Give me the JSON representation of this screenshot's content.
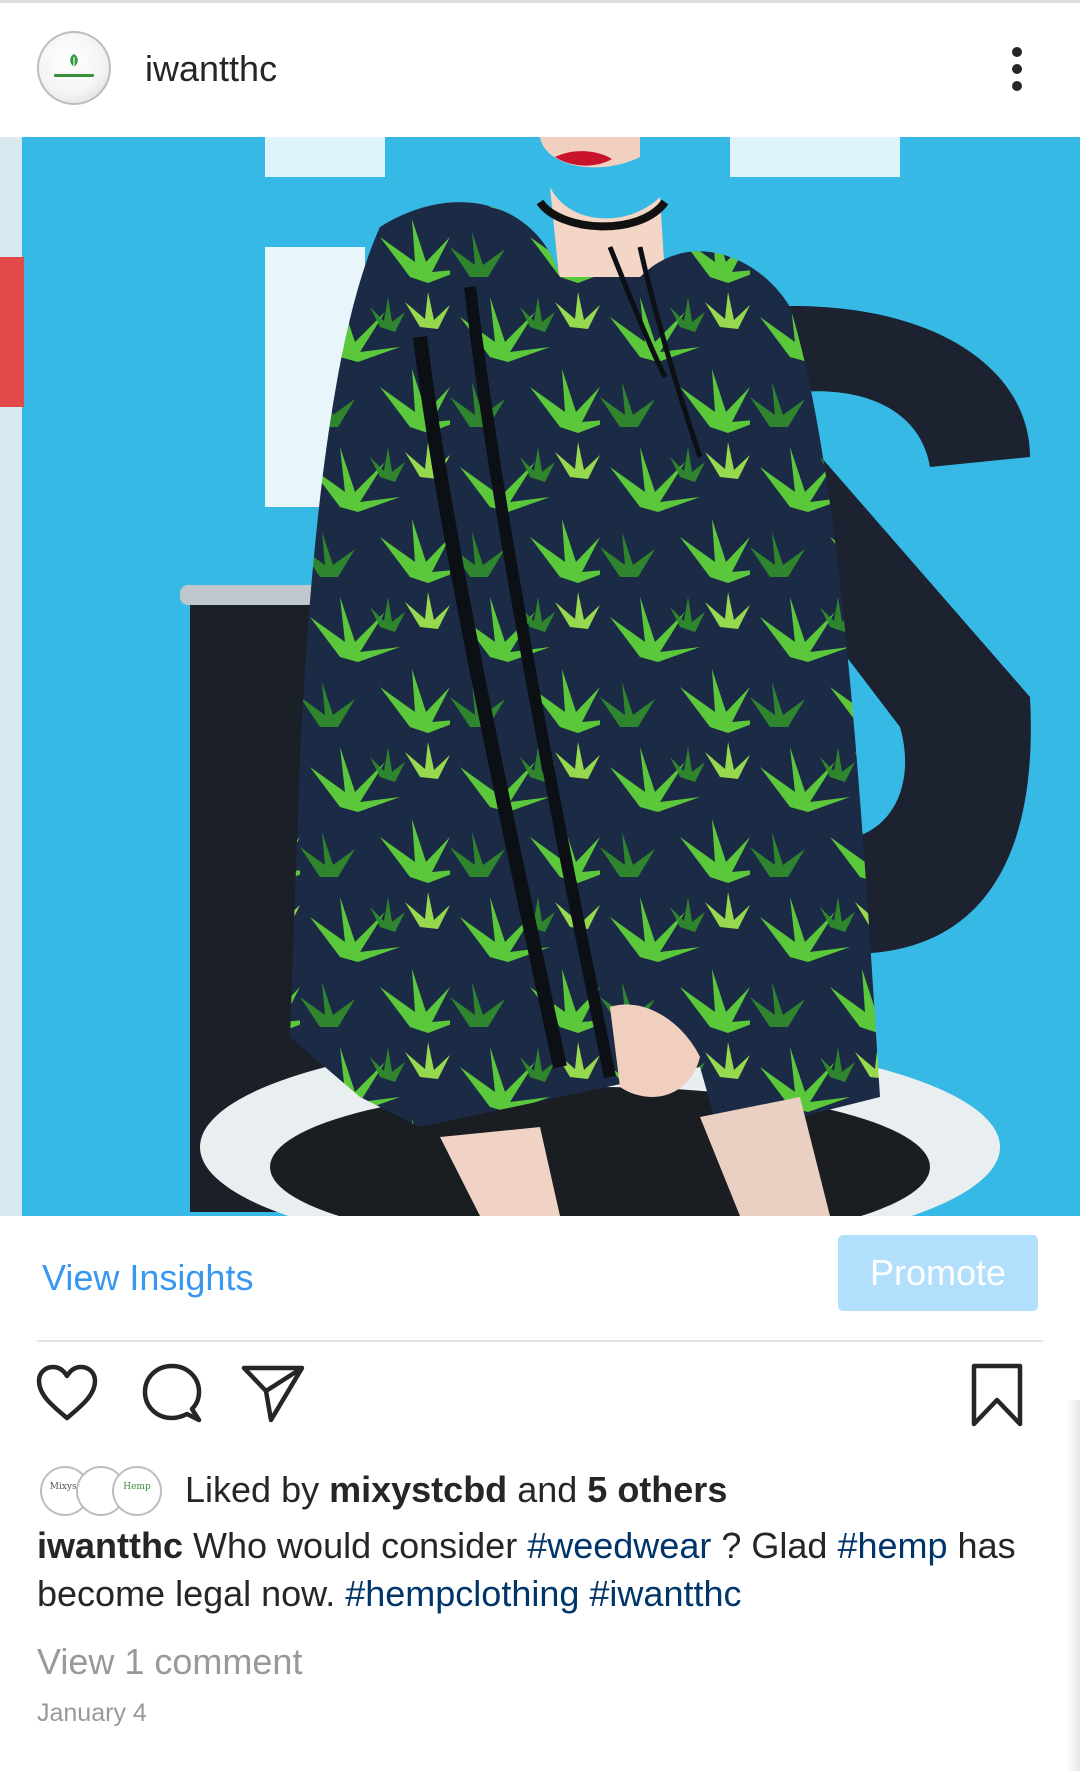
{
  "post": {
    "username": "iwantthc",
    "avatar_icon": "iwantthc-logo-icon",
    "more_icon": "more-vertical-icon",
    "photo_alt": "photo"
  },
  "insights": {
    "view_insights_label": "View Insights",
    "promote_label": "Promote"
  },
  "actions": {
    "like_icon": "heart-icon",
    "comment_icon": "comment-bubble-icon",
    "share_icon": "paper-plane-icon",
    "save_icon": "bookmark-icon"
  },
  "likes": {
    "prefix": "Liked by",
    "first_liker": "mixystcbd",
    "connector": "and",
    "others": "5 others",
    "avatars": [
      "Mixyst",
      "",
      "Hemp"
    ]
  },
  "caption": {
    "username": "iwantthc",
    "text_1": "Who would consider",
    "tag_1": "#weedwear",
    "text_2": "? Glad",
    "tag_2": "#hemp",
    "text_3": "has become legal now.",
    "tag_3": "#hempclothing",
    "tag_4": "#iwantthc"
  },
  "comments": {
    "view_label": "View 1 comment"
  },
  "date": "January 4",
  "colors": {
    "link_blue": "#3897f0",
    "promote_bg": "#b2dffc",
    "hashtag": "#003569",
    "muted": "#999999"
  }
}
